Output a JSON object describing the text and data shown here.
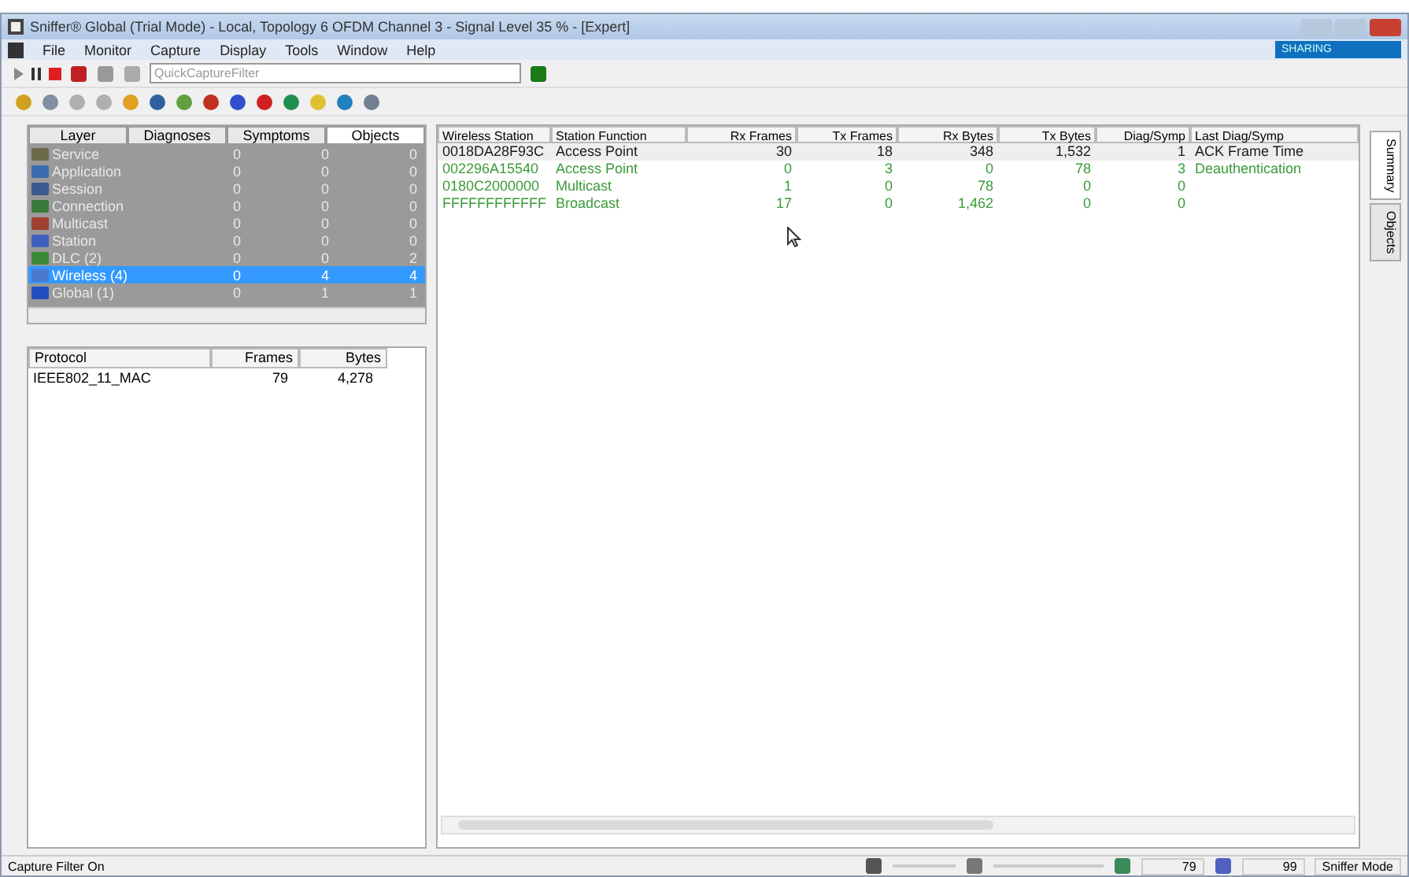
{
  "window": {
    "title": "Sniffer® Global (Trial Mode) - Local, Topology 6 OFDM Channel 3 - Signal Level  35 % - [Expert]",
    "sharing": "SHARING"
  },
  "menu": [
    "File",
    "Monitor",
    "Capture",
    "Display",
    "Tools",
    "Window",
    "Help"
  ],
  "capture_filter": {
    "placeholder": "QuickCaptureFilter"
  },
  "object_tree": {
    "tabs": [
      {
        "label": "Layer",
        "selected": false
      },
      {
        "label": "Diagnoses",
        "selected": false
      },
      {
        "label": "Symptoms",
        "selected": false
      },
      {
        "label": "Objects",
        "selected": true
      }
    ],
    "rows": [
      {
        "name": "Service",
        "values": [
          "0",
          "0",
          "0"
        ],
        "selected": false
      },
      {
        "name": "Application",
        "values": [
          "0",
          "0",
          "0"
        ],
        "selected": false
      },
      {
        "name": "Session",
        "values": [
          "0",
          "0",
          "0"
        ],
        "selected": false
      },
      {
        "name": "Connection",
        "values": [
          "0",
          "0",
          "0"
        ],
        "selected": false
      },
      {
        "name": "Multicast",
        "values": [
          "0",
          "0",
          "0"
        ],
        "selected": false
      },
      {
        "name": "Station",
        "values": [
          "0",
          "0",
          "0"
        ],
        "selected": false
      },
      {
        "name": "DLC (2)",
        "values": [
          "0",
          "0",
          "2"
        ],
        "selected": false
      },
      {
        "name": "Wireless (4)",
        "values": [
          "0",
          "4",
          "4"
        ],
        "selected": true
      },
      {
        "name": "Global (1)",
        "values": [
          "0",
          "1",
          "1"
        ],
        "selected": false
      }
    ]
  },
  "protocol_table": {
    "columns": [
      "Protocol",
      "Frames",
      "Bytes"
    ],
    "rows": [
      [
        "IEEE802_11_MAC",
        "79",
        "4,278"
      ]
    ]
  },
  "station_table": {
    "columns": [
      "Wireless Station",
      "Station Function",
      "Rx Frames",
      "Tx Frames",
      "Rx Bytes",
      "Tx Bytes",
      "Diag/Symp",
      "Last Diag/Symp"
    ],
    "rows": [
      {
        "cells": [
          "0018DA28F93C",
          "Access Point",
          "30",
          "18",
          "348",
          "1,532",
          "1",
          "ACK Frame Time"
        ],
        "color": "#1a1a1a",
        "selected": true
      },
      {
        "cells": [
          "002296A15540",
          "Access Point",
          "0",
          "3",
          "0",
          "78",
          "3",
          "Deauthentication"
        ],
        "color": "#3a9a3a",
        "selected": false
      },
      {
        "cells": [
          "0180C2000000",
          "Multicast",
          "1",
          "0",
          "78",
          "0",
          "0",
          ""
        ],
        "color": "#3a9a3a",
        "selected": false
      },
      {
        "cells": [
          "FFFFFFFFFFFF",
          "Broadcast",
          "17",
          "0",
          "1,462",
          "0",
          "0",
          ""
        ],
        "color": "#3a9a3a",
        "selected": false
      }
    ]
  },
  "side_tabs": [
    {
      "label": "Summary",
      "selected": true
    },
    {
      "label": "Objects",
      "selected": false
    }
  ],
  "status_bar": {
    "message": "Capture Filter On",
    "frames": "79",
    "percent": "99",
    "mode": "Sniffer Mode"
  }
}
